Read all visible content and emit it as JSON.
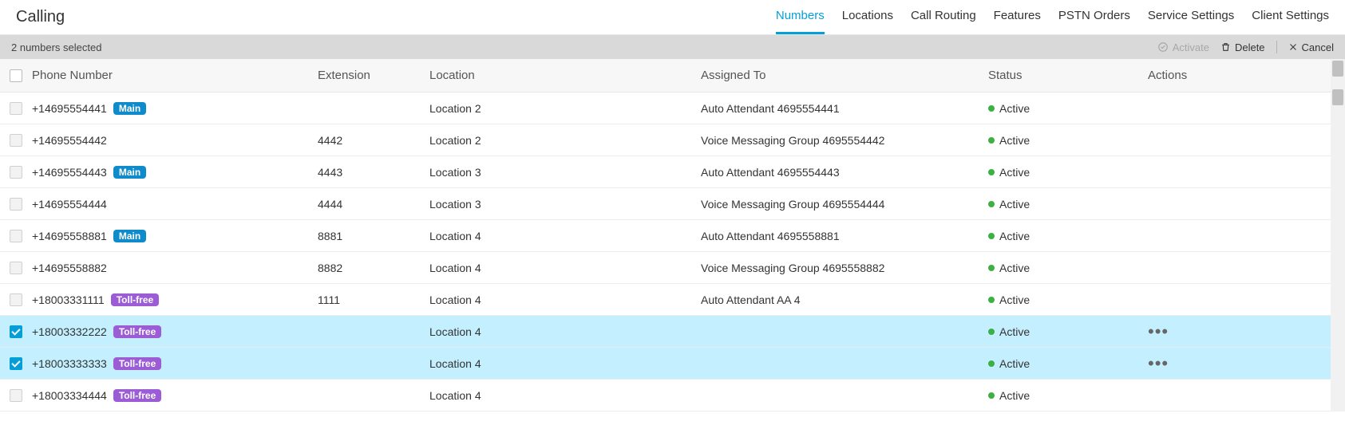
{
  "header": {
    "title": "Calling",
    "tabs": [
      {
        "label": "Numbers",
        "active": true
      },
      {
        "label": "Locations",
        "active": false
      },
      {
        "label": "Call Routing",
        "active": false
      },
      {
        "label": "Features",
        "active": false
      },
      {
        "label": "PSTN Orders",
        "active": false
      },
      {
        "label": "Service Settings",
        "active": false
      },
      {
        "label": "Client Settings",
        "active": false
      }
    ]
  },
  "selectionBar": {
    "text": "2 numbers selected",
    "activate": "Activate",
    "delete": "Delete",
    "cancel": "Cancel"
  },
  "columns": {
    "phone": "Phone Number",
    "extension": "Extension",
    "location": "Location",
    "assigned": "Assigned To",
    "status": "Status",
    "actions": "Actions"
  },
  "badges": {
    "main": "Main",
    "toll": "Toll-free"
  },
  "statusActive": "Active",
  "rows": [
    {
      "phone": "+14695554441",
      "badge": "main",
      "extension": "",
      "location": "Location 2",
      "assigned": "Auto Attendant 4695554441",
      "status": "Active",
      "selectable": false,
      "selected": false,
      "showActions": false
    },
    {
      "phone": "+14695554442",
      "badge": null,
      "extension": "4442",
      "location": "Location 2",
      "assigned": "Voice Messaging Group 4695554442",
      "status": "Active",
      "selectable": false,
      "selected": false,
      "showActions": false
    },
    {
      "phone": "+14695554443",
      "badge": "main",
      "extension": "4443",
      "location": "Location 3",
      "assigned": "Auto Attendant 4695554443",
      "status": "Active",
      "selectable": false,
      "selected": false,
      "showActions": false
    },
    {
      "phone": "+14695554444",
      "badge": null,
      "extension": "4444",
      "location": "Location 3",
      "assigned": "Voice Messaging Group 4695554444",
      "status": "Active",
      "selectable": false,
      "selected": false,
      "showActions": false
    },
    {
      "phone": "+14695558881",
      "badge": "main",
      "extension": "8881",
      "location": "Location 4",
      "assigned": "Auto Attendant 4695558881",
      "status": "Active",
      "selectable": false,
      "selected": false,
      "showActions": false
    },
    {
      "phone": "+14695558882",
      "badge": null,
      "extension": "8882",
      "location": "Location 4",
      "assigned": "Voice Messaging Group 4695558882",
      "status": "Active",
      "selectable": false,
      "selected": false,
      "showActions": false
    },
    {
      "phone": "+18003331111",
      "badge": "toll",
      "extension": "1111",
      "location": "Location 4",
      "assigned": "Auto Attendant AA 4",
      "status": "Active",
      "selectable": false,
      "selected": false,
      "showActions": false
    },
    {
      "phone": "+18003332222",
      "badge": "toll",
      "extension": "",
      "location": "Location 4",
      "assigned": "",
      "status": "Active",
      "selectable": true,
      "selected": true,
      "showActions": true
    },
    {
      "phone": "+18003333333",
      "badge": "toll",
      "extension": "",
      "location": "Location 4",
      "assigned": "",
      "status": "Active",
      "selectable": true,
      "selected": true,
      "showActions": true
    },
    {
      "phone": "+18003334444",
      "badge": "toll",
      "extension": "",
      "location": "Location 4",
      "assigned": "",
      "status": "Active",
      "selectable": false,
      "selected": false,
      "showActions": false
    }
  ]
}
